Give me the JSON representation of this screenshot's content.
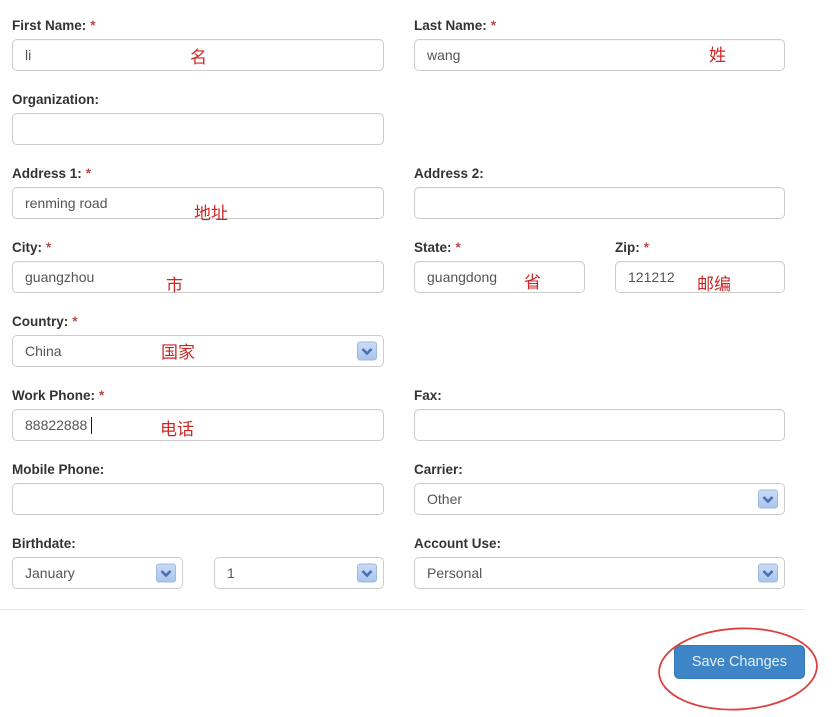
{
  "form": {
    "first_name": {
      "label": "First Name:",
      "required_mark": "*",
      "value": "li",
      "annotation": "名"
    },
    "last_name": {
      "label": "Last Name:",
      "required_mark": "*",
      "value": "wang",
      "annotation": "姓"
    },
    "organization": {
      "label": "Organization:",
      "value": ""
    },
    "address1": {
      "label": "Address 1:",
      "required_mark": "*",
      "value": "renming road",
      "annotation": "地址"
    },
    "address2": {
      "label": "Address 2:",
      "value": ""
    },
    "city": {
      "label": "City:",
      "required_mark": "*",
      "value": "guangzhou",
      "annotation": "市"
    },
    "state": {
      "label": "State:",
      "required_mark": "*",
      "value": "guangdong",
      "annotation": "省"
    },
    "zip": {
      "label": "Zip:",
      "required_mark": "*",
      "value": "121212",
      "annotation": "邮编"
    },
    "country": {
      "label": "Country:",
      "required_mark": "*",
      "selected": "China",
      "annotation": "国家"
    },
    "work_phone": {
      "label": "Work Phone:",
      "required_mark": "*",
      "value": "88822888",
      "annotation": "电话"
    },
    "fax": {
      "label": "Fax:",
      "value": ""
    },
    "mobile_phone": {
      "label": "Mobile Phone:",
      "value": ""
    },
    "carrier": {
      "label": "Carrier:",
      "selected": "Other"
    },
    "birthdate": {
      "label": "Birthdate:",
      "month_selected": "January",
      "day_selected": "1"
    },
    "account_use": {
      "label": "Account Use:",
      "selected": "Personal"
    }
  },
  "actions": {
    "save_label": "Save Changes"
  },
  "colors": {
    "annotation_red": "#cc2626",
    "required_red": "#b34a4a",
    "button_blue": "#3d85c6",
    "circle_red": "#dd4040",
    "input_border": "#cccccc",
    "label_text": "#333333",
    "input_text": "#555555"
  }
}
